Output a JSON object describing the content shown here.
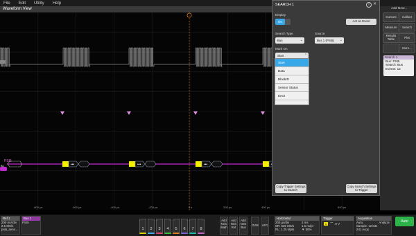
{
  "menu": [
    "File",
    "Edit",
    "Utility",
    "Help"
  ],
  "waveform": {
    "title": "Waveform View",
    "time_axis": [
      "-800 µs",
      "-600 µs",
      "-400 µs",
      "-200 µs",
      "0 s",
      "200 µs",
      "400 µs",
      "600 µs"
    ],
    "bus_label": "PSI5",
    "ch_marker": "B1"
  },
  "right_panel": {
    "add_new": "Add New...",
    "buttons": [
      "Cursors",
      "Callout",
      "Measure",
      "Search",
      "Results Table",
      "Plot",
      "",
      "More..."
    ]
  },
  "search_badge": {
    "header": "Search 1",
    "lines": [
      "Bus: PSI5",
      "Search: Bus",
      "Events: 12"
    ]
  },
  "dialog": {
    "title": "SEARCH 1",
    "display_label": "Display",
    "display_value": "On",
    "act_on_event": "Act on Event",
    "search_type_label": "Search Type",
    "search_type_value": "Bus",
    "source_label": "Source",
    "source_value": "Bus 1 (PSI5)",
    "mark_on_label": "Mark On",
    "mark_on_value": "Start",
    "options": [
      "Start",
      "Data",
      "BlockID",
      "Sensor Status",
      "Error"
    ],
    "copy_trigger": "Copy Trigger Settings to Search",
    "copy_search": "Copy Search Settings to Trigger"
  },
  "bottom": {
    "ref": {
      "h": "Ref 1",
      "l": [
        "200 mV/div",
        "2.5 MS/s",
        "psi5_sens..."
      ]
    },
    "bus": {
      "h": "Bus 1",
      "l": [
        "PSI5"
      ]
    },
    "channels": [
      "1",
      "2",
      "3",
      "4",
      "5",
      "6",
      "7",
      "8"
    ],
    "small": [
      {
        "l": [
          "Add",
          "New",
          "Math"
        ]
      },
      {
        "l": [
          "Add",
          "New",
          "Ref"
        ]
      },
      {
        "l": [
          "Add",
          "New",
          "Bus"
        ]
      },
      {
        "l": [
          "DVM"
        ]
      },
      {
        "l": [
          "AFG"
        ]
      }
    ],
    "horizontal": {
      "h": "Horizontal",
      "l": [
        "200 µs/div",
        "SR: 625 MS/s",
        "RL: 1.25 Mpts",
        "2 ms",
        "1.6 ns/pt",
        "▼ 50%"
      ]
    },
    "trigger": {
      "h": "Trigger",
      "l": [
        "0 V"
      ]
    },
    "acquisition": {
      "h": "Acquisition",
      "l": [
        "Auto,",
        "Analyze",
        "Sample: 12 bits",
        "241 Acqs"
      ]
    },
    "run_label": "Auto"
  },
  "colors": {
    "bus": "#c02bd0",
    "packet": "#f4f000",
    "trace": "#c8c8c8",
    "marker": "#e08ae0",
    "cursor": "#f58a22"
  }
}
